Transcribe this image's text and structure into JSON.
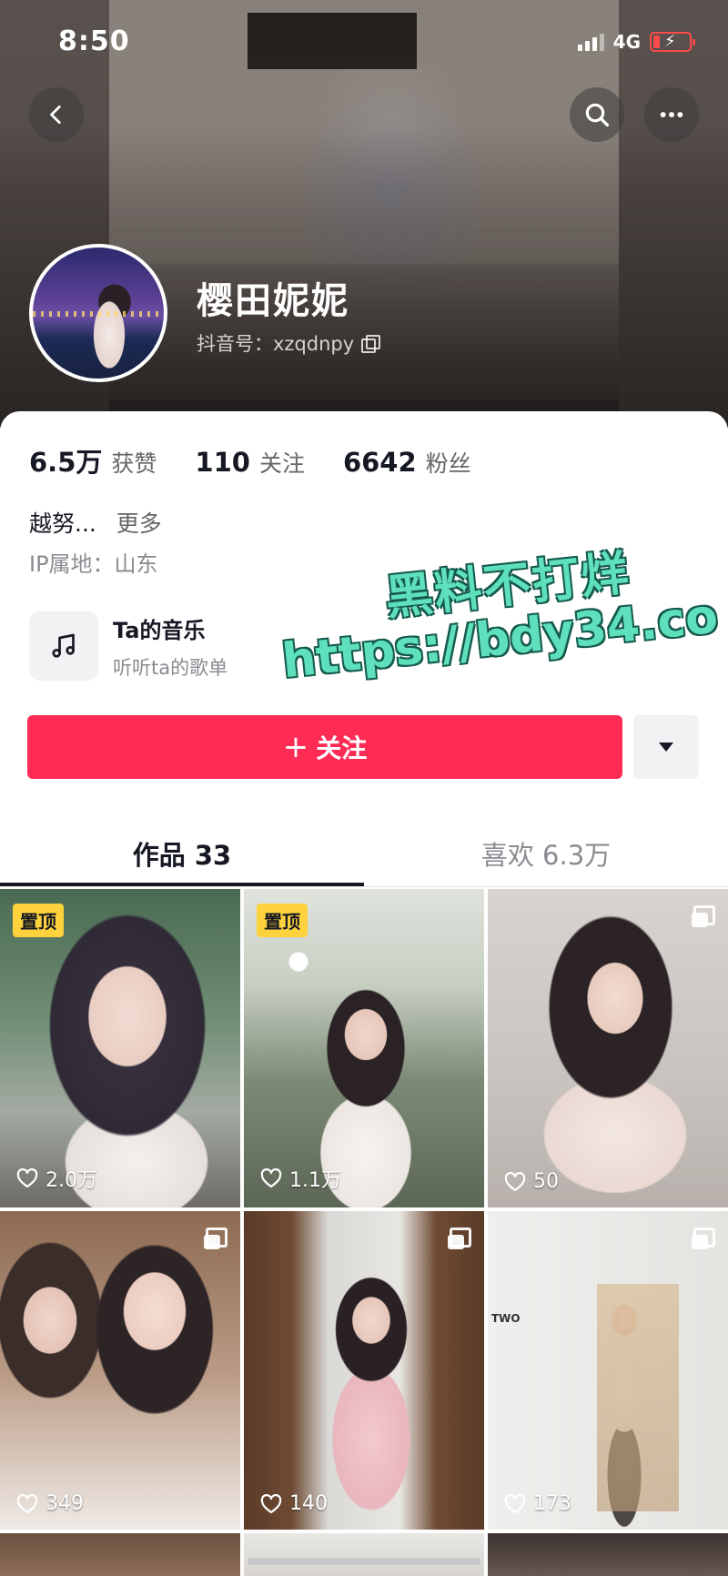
{
  "status_bar": {
    "time": "8:50",
    "network": "4G"
  },
  "header": {
    "back_icon": "chevron-left-icon",
    "search_icon": "search-icon",
    "more_icon": "more-horizontal-icon"
  },
  "profile": {
    "name": "樱田妮妮",
    "handle": "抖音号：xzqdnpy",
    "stats": [
      {
        "num": "6.5万",
        "label": "获赞"
      },
      {
        "num": "110",
        "label": "关注"
      },
      {
        "num": "6642",
        "label": "粉丝"
      }
    ],
    "bio": "越努...",
    "bio_more": "更多",
    "ip": "IP属地：山东"
  },
  "music": {
    "title": "Ta的音乐",
    "subtitle": "听听ta的歌单"
  },
  "watermark": {
    "line1": "黑料不打烊",
    "line2": "https://bdy34.co"
  },
  "actions": {
    "follow_plus": "+",
    "follow_label": "关注"
  },
  "tabs": [
    {
      "label": "作品 33"
    },
    {
      "label": "喜欢 6.3万"
    }
  ],
  "grid": {
    "pin_label": "置顶",
    "tiles": [
      {
        "likes": "2.0万"
      },
      {
        "likes": "1.1万"
      },
      {
        "likes": "50"
      },
      {
        "likes": "349"
      },
      {
        "likes": "140"
      },
      {
        "likes": "173"
      }
    ],
    "tile6_sign": "TWO"
  },
  "colors": {
    "accent": "#fe2c55",
    "pin": "#fdd23c",
    "watermark": "#5fe0bd"
  }
}
